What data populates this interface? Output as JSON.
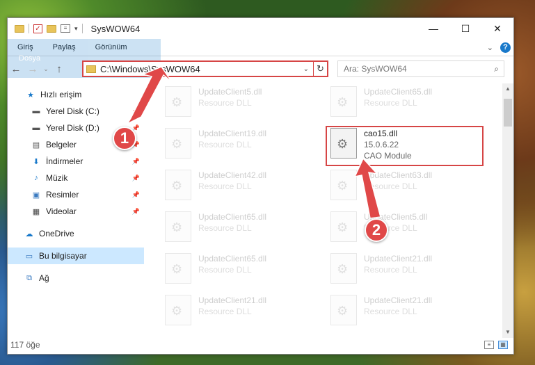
{
  "window": {
    "title": "SysWOW64"
  },
  "window_controls": {
    "minimize": "—",
    "maximize": "☐",
    "close": "✕"
  },
  "ribbon": {
    "tabs": [
      "Dosya",
      "Giriş",
      "Paylaş",
      "Görünüm"
    ],
    "help": "?"
  },
  "address_bar": {
    "path": "C:\\Windows\\SysWOW64"
  },
  "search": {
    "placeholder": "Ara: SysWOW64"
  },
  "sidebar": {
    "items": [
      {
        "label": "Hızlı erişim",
        "icon": "star-icon"
      },
      {
        "label": "Yerel Disk (C:)",
        "icon": "drive-icon"
      },
      {
        "label": "Yerel Disk (D:)",
        "icon": "drive-icon"
      },
      {
        "label": "Belgeler",
        "icon": "documents-icon"
      },
      {
        "label": "İndirmeler",
        "icon": "download-icon"
      },
      {
        "label": "Müzik",
        "icon": "music-icon"
      },
      {
        "label": "Resimler",
        "icon": "pictures-icon"
      },
      {
        "label": "Videolar",
        "icon": "video-icon"
      },
      {
        "label": "OneDrive",
        "icon": "cloud-icon"
      },
      {
        "label": "Bu bilgisayar",
        "icon": "computer-icon"
      },
      {
        "label": "Ağ",
        "icon": "network-icon"
      }
    ]
  },
  "files": [
    {
      "name": "UpdateClient5.dll",
      "sub": "Resource DLL"
    },
    {
      "name": "UpdateClient65.dll",
      "sub": "Resource DLL"
    },
    {
      "name": "UpdateClient19.dll",
      "sub": "Resource DLL"
    },
    {
      "name": "cao15.dll",
      "sub": "15.0.6.22",
      "sub2": "CAO Module"
    },
    {
      "name": "UpdateClient42.dll",
      "sub": "Resource DLL"
    },
    {
      "name": "UpdateClient63.dll",
      "sub": "Resource DLL"
    },
    {
      "name": "UpdateClient65.dll",
      "sub": "Resource DLL"
    },
    {
      "name": "UpdateClient5.dll",
      "sub": "Resource DLL"
    },
    {
      "name": "UpdateClient65.dll",
      "sub": "Resource DLL"
    },
    {
      "name": "UpdateClient21.dll",
      "sub": "Resource DLL"
    },
    {
      "name": "UpdateClient21.dll",
      "sub": "Resource DLL"
    },
    {
      "name": "UpdateClient21.dll",
      "sub": "Resource DLL"
    }
  ],
  "status": {
    "count": "117 öğe"
  },
  "annotations": {
    "badge1": "1",
    "badge2": "2"
  },
  "colors": {
    "accent": "#1979ca",
    "highlight": "#d64545",
    "selection": "#cce8ff"
  }
}
